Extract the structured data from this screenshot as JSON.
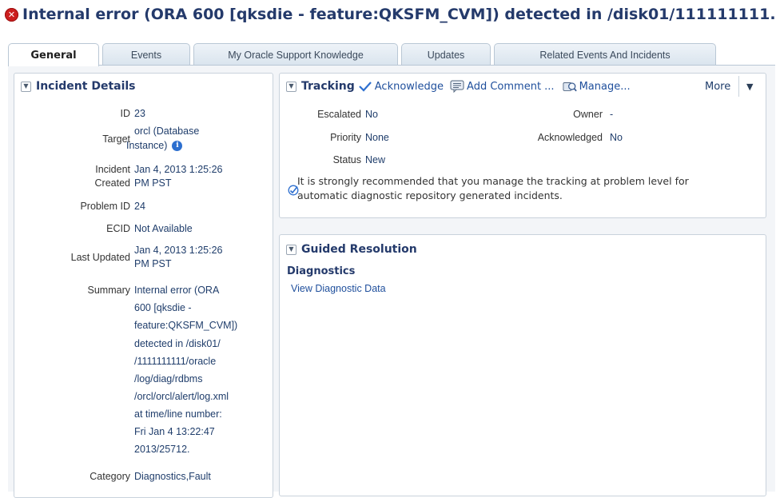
{
  "window": {
    "title": "Internal error (ORA 600 [qksdie - feature:QKSFM_CVM]) detected in /disk01/111111111..."
  },
  "tabs": [
    {
      "label": "General",
      "active": true
    },
    {
      "label": "Events",
      "active": false
    },
    {
      "label": "My Oracle Support Knowledge",
      "active": false
    },
    {
      "label": "Updates",
      "active": false
    },
    {
      "label": "Related Events And Incidents",
      "active": false
    }
  ],
  "incident_details": {
    "title": "Incident Details",
    "id_label": "ID",
    "id_value": "23",
    "target_label": "Target",
    "target_value_1": "orcl  (Database",
    "target_value_2": "Instance)",
    "incident_created_label_1": "Incident",
    "incident_created_label_2": "Created",
    "incident_created_value_1": "Jan 4, 2013 1:25:26",
    "incident_created_value_2": "PM PST",
    "problem_id_label": "Problem ID",
    "problem_id_value": "24",
    "ecid_label": "ECID",
    "ecid_value": "Not Available",
    "last_updated_label": "Last Updated",
    "last_updated_value_1": "Jan 4, 2013 1:25:26",
    "last_updated_value_2": "PM PST",
    "summary_label": "Summary",
    "summary_lines": [
      "Internal error (ORA",
      "600 [qksdie -",
      "feature:QKSFM_CVM])",
      "detected in /disk01/",
      "/1111111111/oracle",
      "/log/diag/rdbms",
      "/orcl/orcl/alert/log.xml",
      "at time/line number:",
      "Fri Jan 4 13:22:47",
      "2013/25712."
    ],
    "category_label": "Category",
    "category_value": "Diagnostics,Fault"
  },
  "tracking": {
    "title": "Tracking",
    "acknowledge_label": "Acknowledge",
    "add_comment_label": "Add Comment ...",
    "manage_label": "Manage...",
    "more_label": "More",
    "escalated_label": "Escalated",
    "escalated_value": "No",
    "priority_label": "Priority",
    "priority_value": "None",
    "status_label": "Status",
    "status_value": "New",
    "owner_label": "Owner",
    "owner_value": "-",
    "acknowledged_label": "Acknowledged",
    "acknowledged_value": "No",
    "note_line_1": "It is strongly recommended that you manage the tracking at problem level for",
    "note_line_2": "automatic diagnostic repository generated incidents."
  },
  "guided_resolution": {
    "title": "Guided Resolution",
    "diagnostics_heading": "Diagnostics",
    "view_link": "View Diagnostic Data"
  },
  "colors": {
    "title": "#243a6b",
    "link": "#1f4f9c",
    "error": "#cc1f1f"
  }
}
